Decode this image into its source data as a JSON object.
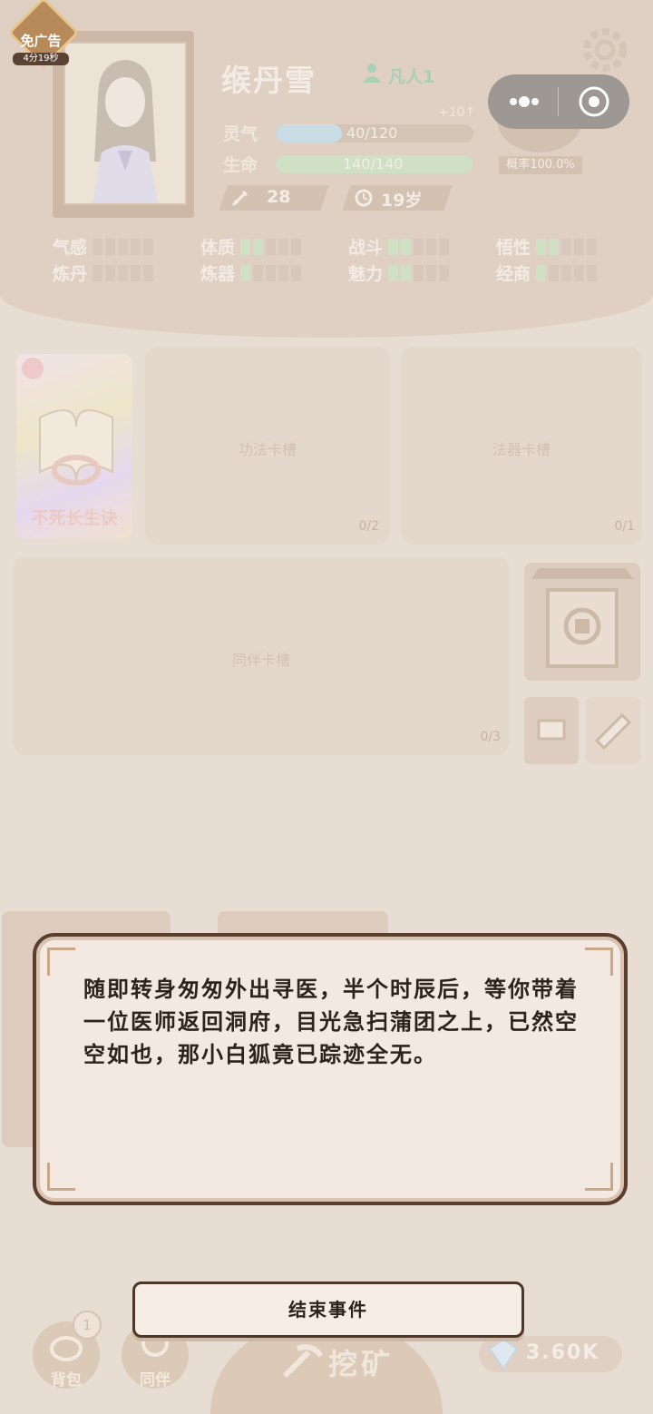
{
  "ad_badge": {
    "title": "免广告",
    "timer": "4分19秒"
  },
  "character": {
    "name": "缑丹雪",
    "rank": "凡人1",
    "bonus": "+10↑",
    "spirit": {
      "label": "灵气",
      "value": "40/120",
      "fraction": 0.333
    },
    "life": {
      "label": "生命",
      "value": "140/140",
      "fraction": 1.0
    },
    "power": "28",
    "age": "19岁"
  },
  "breakthrough": {
    "label": "突破",
    "chance": "概率100.0%"
  },
  "attributes": [
    {
      "label": "气感",
      "level": 0
    },
    {
      "label": "体质",
      "level": 2
    },
    {
      "label": "战斗",
      "level": 2
    },
    {
      "label": "悟性",
      "level": 2
    },
    {
      "label": "炼丹",
      "level": 0
    },
    {
      "label": "炼器",
      "level": 1
    },
    {
      "label": "魅力",
      "level": 2
    },
    {
      "label": "经商",
      "level": 1
    }
  ],
  "slots": {
    "card_name": "不死长生诀",
    "technique": {
      "label": "功法卡槽",
      "count": "0/2"
    },
    "artifact": {
      "label": "法器卡槽",
      "count": "0/1"
    },
    "companion": {
      "label": "同伴卡槽",
      "count": "0/3"
    }
  },
  "dialog": {
    "text": "随即转身匆匆外出寻医，半个时辰后，等你带着一位医师返回洞府，目光急扫蒲团之上，已然空空如也，那小白狐竟已踪迹全无。",
    "button": "结束事件"
  },
  "bottom_nav": {
    "bag": "背包",
    "bag_badge": "1",
    "companion": "同伴",
    "mine": "挖矿",
    "currency": "3.60K"
  },
  "colors": {
    "background": "#e7ddd3",
    "dialog_border": "#5c3e31",
    "spirit_bar": "#c9dbe3",
    "life_bar": "#cfe0c4"
  }
}
